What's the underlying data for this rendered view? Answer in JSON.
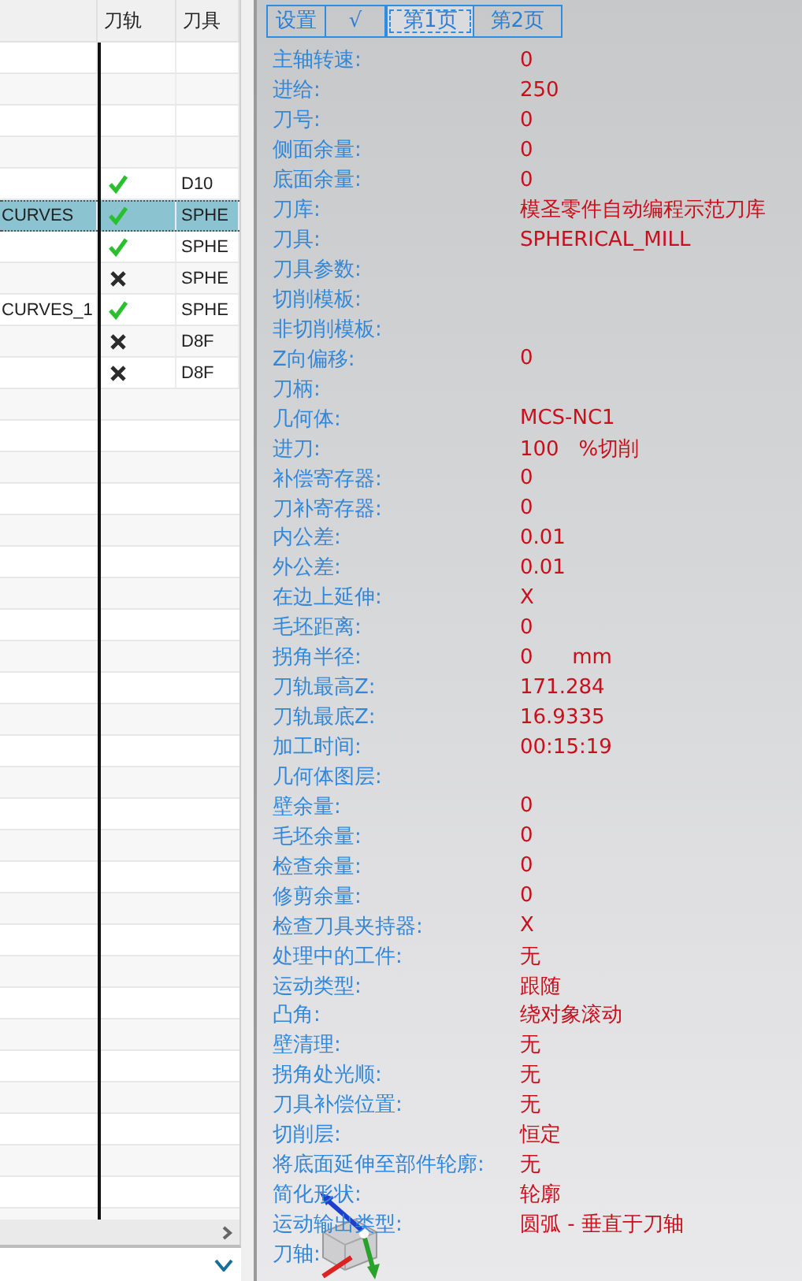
{
  "table": {
    "columns": [
      {},
      {
        "label": "刀轨"
      },
      {
        "label": "刀具"
      }
    ],
    "rows": [
      {
        "selected": false
      },
      {
        "selected": false
      },
      {
        "selected": false
      },
      {
        "selected": false
      },
      {
        "toolpath_ok": true,
        "tool": "D10",
        "selected": false
      },
      {
        "name": "CURVES",
        "toolpath_ok": true,
        "tool": "SPHE",
        "selected": true
      },
      {
        "toolpath_ok": true,
        "tool": "SPHE",
        "selected": false
      },
      {
        "toolpath_ok": false,
        "tool": "SPHE",
        "selected": false
      },
      {
        "name": "CURVES_1",
        "toolpath_ok": true,
        "tool": "SPHE",
        "selected": false
      },
      {
        "toolpath_ok": false,
        "tool": "D8F",
        "selected": false
      },
      {
        "toolpath_ok": false,
        "tool": "D8F",
        "selected": false
      }
    ]
  },
  "tabs": [
    {
      "label": "设置",
      "selected": false
    },
    {
      "label": "√",
      "selected": false
    },
    {
      "label": "第1页",
      "selected": true
    },
    {
      "label": "第2页",
      "selected": false
    }
  ],
  "properties": [
    {
      "label": "主轴转速:",
      "value": "0"
    },
    {
      "label": "进给:",
      "value": "250"
    },
    {
      "label": "刀号:",
      "value": "0"
    },
    {
      "label": "侧面余量:",
      "value": "0"
    },
    {
      "label": "底面余量:",
      "value": "0"
    },
    {
      "label": "刀库:",
      "value": "模圣零件自动编程示范刀库"
    },
    {
      "label": "刀具:",
      "value": "SPHERICAL_MILL"
    },
    {
      "label": "刀具参数:"
    },
    {
      "label": "切削模板:"
    },
    {
      "label": "非切削模板:"
    },
    {
      "label": "Z向偏移:",
      "value": "0"
    },
    {
      "label": "刀柄:"
    },
    {
      "label": "几何体:",
      "value": "MCS-NC1"
    },
    {
      "label": "进刀:",
      "value": "100   %切削"
    },
    {
      "label": "补偿寄存器:",
      "value": "0"
    },
    {
      "label": "刀补寄存器:",
      "value": "0"
    },
    {
      "label": "内公差:",
      "value": "0.01"
    },
    {
      "label": "外公差:",
      "value": "0.01"
    },
    {
      "label": "在边上延伸:",
      "value": "X"
    },
    {
      "label": "毛坯距离:",
      "value": "0"
    },
    {
      "label": "拐角半径:",
      "value": "0      mm"
    },
    {
      "label": "刀轨最高Z:",
      "value": "171.284"
    },
    {
      "label": "刀轨最底Z:",
      "value": "16.9335"
    },
    {
      "label": "加工时间:",
      "value": "00:15:19"
    },
    {
      "label": "几何体图层:"
    },
    {
      "label": "壁余量:",
      "value": "0"
    },
    {
      "label": "毛坯余量:",
      "value": "0"
    },
    {
      "label": "检查余量:",
      "value": "0"
    },
    {
      "label": "修剪余量:",
      "value": "0"
    },
    {
      "label": "检查刀具夹持器:",
      "value": "X"
    },
    {
      "label": "处理中的工件:",
      "value": "无"
    },
    {
      "label": "运动类型:",
      "value": "跟随"
    },
    {
      "label": "凸角:",
      "value": "绕对象滚动"
    },
    {
      "label": "壁清理:",
      "value": "无"
    },
    {
      "label": "拐角处光顺:",
      "value": "无"
    },
    {
      "label": "刀具补偿位置:",
      "value": "无"
    },
    {
      "label": "切削层:",
      "value": "恒定"
    },
    {
      "label": "将底面延伸至部件轮廓:",
      "value": "无"
    },
    {
      "label": "简化形状:",
      "value": "轮廓"
    },
    {
      "label": "运动输出类型:",
      "value": "圆弧 - 垂直于刀轴"
    },
    {
      "label": "刀轴:"
    }
  ]
}
